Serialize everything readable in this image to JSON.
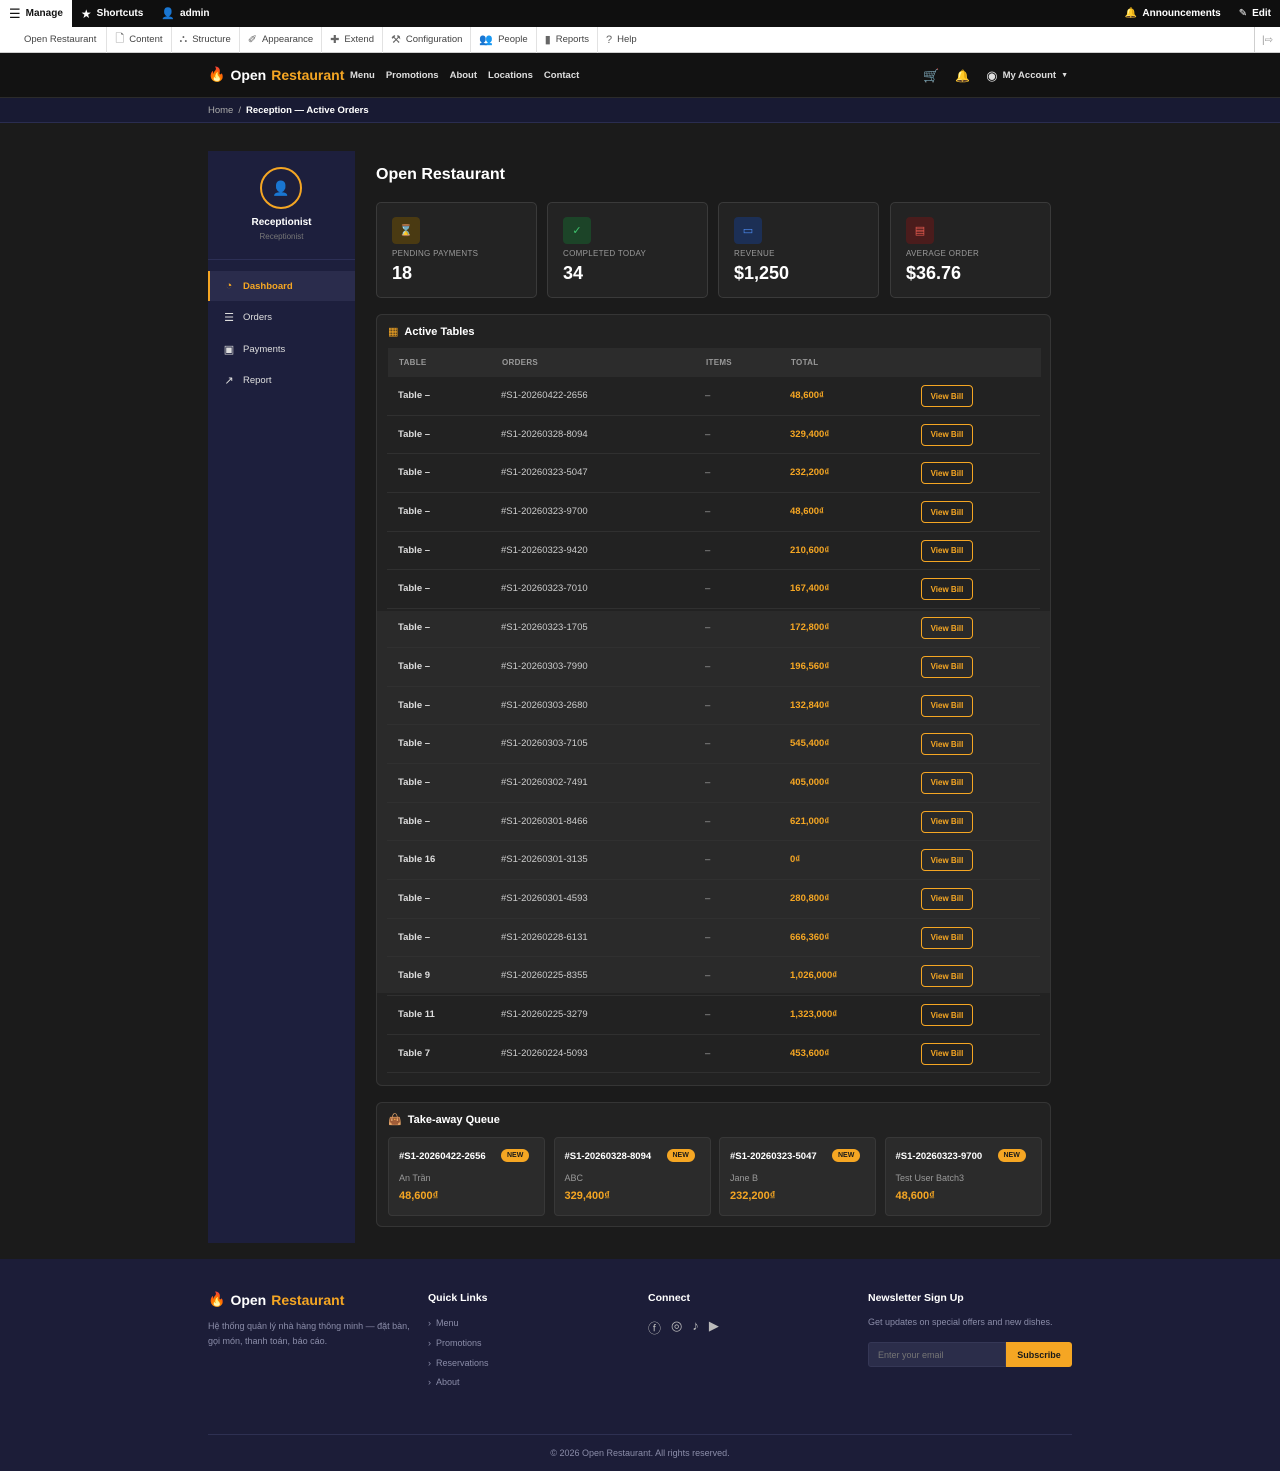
{
  "toolbar": {
    "manage": "Manage",
    "shortcuts": "Shortcuts",
    "user": "admin",
    "announcements": "Announcements",
    "edit": "Edit"
  },
  "admin_menu": [
    "Open Restaurant",
    "Content",
    "Structure",
    "Appearance",
    "Extend",
    "Configuration",
    "People",
    "Reports",
    "Help"
  ],
  "nav": {
    "brand_open": "Open",
    "brand_rest": "Restaurant",
    "links": [
      "Menu",
      "Promotions",
      "About",
      "Locations",
      "Contact"
    ],
    "account": "My Account"
  },
  "breadcrumb": {
    "home": "Home",
    "sep": "/",
    "current": "Reception — Active Orders"
  },
  "sidebar": {
    "role": "Receptionist",
    "subrole": "Receptionist",
    "items": [
      "Dashboard",
      "Orders",
      "Payments",
      "Report"
    ]
  },
  "page": {
    "title": "Open Restaurant"
  },
  "stats": [
    {
      "label": "PENDING PAYMENTS",
      "value": "18",
      "icon": "hourglass-icon"
    },
    {
      "label": "COMPLETED TODAY",
      "value": "34",
      "icon": "check-circle-icon"
    },
    {
      "label": "REVENUE",
      "value": "$1,250",
      "icon": "cash-icon"
    },
    {
      "label": "AVERAGE ORDER",
      "value": "$36.76",
      "icon": "receipt-icon"
    }
  ],
  "tables": {
    "title": "Active Tables",
    "headers": [
      "TABLE",
      "ORDERS",
      "ITEMS",
      "TOTAL"
    ],
    "button": "View Bill",
    "rows": [
      [
        "Table –",
        "#S1-20260422-2656",
        "–",
        "48,600₫"
      ],
      [
        "Table –",
        "#S1-20260328-8094",
        "–",
        "329,400₫"
      ],
      [
        "Table –",
        "#S1-20260323-5047",
        "–",
        "232,200₫"
      ],
      [
        "Table –",
        "#S1-20260323-9700",
        "–",
        "48,600₫"
      ],
      [
        "Table –",
        "#S1-20260323-9420",
        "–",
        "210,600₫"
      ],
      [
        "Table –",
        "#S1-20260323-7010",
        "–",
        "167,400₫"
      ],
      [
        "Table –",
        "#S1-20260323-1705",
        "–",
        "172,800₫"
      ],
      [
        "Table –",
        "#S1-20260303-7990",
        "–",
        "196,560₫"
      ],
      [
        "Table –",
        "#S1-20260303-2680",
        "–",
        "132,840₫"
      ],
      [
        "Table –",
        "#S1-20260303-7105",
        "–",
        "545,400₫"
      ],
      [
        "Table –",
        "#S1-20260302-7491",
        "–",
        "405,000₫"
      ],
      [
        "Table –",
        "#S1-20260301-8466",
        "–",
        "621,000₫"
      ],
      [
        "Table 16",
        "#S1-20260301-3135",
        "–",
        "0₫"
      ],
      [
        "Table –",
        "#S1-20260301-4593",
        "–",
        "280,800₫"
      ],
      [
        "Table –",
        "#S1-20260228-6131",
        "–",
        "666,360₫"
      ],
      [
        "Table 9",
        "#S1-20260225-8355",
        "–",
        "1,026,000₫"
      ],
      [
        "Table 11",
        "#S1-20260225-3279",
        "–",
        "1,323,000₫"
      ],
      [
        "Table 7",
        "#S1-20260224-5093",
        "–",
        "453,600₫"
      ]
    ]
  },
  "queue": {
    "title": "Take-away Queue",
    "badge": "NEW",
    "items": [
      {
        "id": "#S1-20260422-2656",
        "name": "An Trần",
        "amount": "48,600₫"
      },
      {
        "id": "#S1-20260328-8094",
        "name": "ABC",
        "amount": "329,400₫"
      },
      {
        "id": "#S1-20260323-5047",
        "name": "Jane B",
        "amount": "232,200₫"
      },
      {
        "id": "#S1-20260323-9700",
        "name": "Test User Batch3",
        "amount": "48,600₫"
      }
    ]
  },
  "footer": {
    "desc": "Hệ thống quản lý nhà hàng thông minh — đặt bàn, gọi món, thanh toán, báo cáo.",
    "quick_title": "Quick Links",
    "quick_links": [
      "Menu",
      "Promotions",
      "Reservations",
      "About"
    ],
    "connect_title": "Connect",
    "newsletter_title": "Newsletter Sign Up",
    "newsletter_text": "Get updates on special offers and new dishes.",
    "email_placeholder": "Enter your email",
    "subscribe": "Subscribe",
    "copyright": "© 2026 Open Restaurant. All rights reserved."
  },
  "colors": {
    "accent": "#f5a623",
    "sidebar": "#1d1f3d",
    "bg": "#1b1b1b"
  }
}
